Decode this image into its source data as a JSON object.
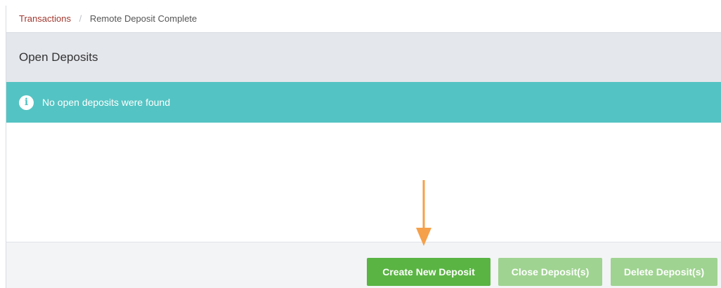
{
  "breadcrumb": {
    "parent": "Transactions",
    "separator": "/",
    "current": "Remote Deposit Complete"
  },
  "panel": {
    "title": "Open Deposits"
  },
  "alert": {
    "icon": "info-icon",
    "message": "No open deposits were found",
    "color": "#54c3c3"
  },
  "actions": {
    "create_label": "Create New Deposit",
    "close_label": "Close Deposit(s)",
    "delete_label": "Delete Deposit(s)",
    "primary_color": "#5ab443",
    "disabled_color": "#9fd391"
  },
  "annotation": {
    "arrow_color": "#f5a04a"
  }
}
